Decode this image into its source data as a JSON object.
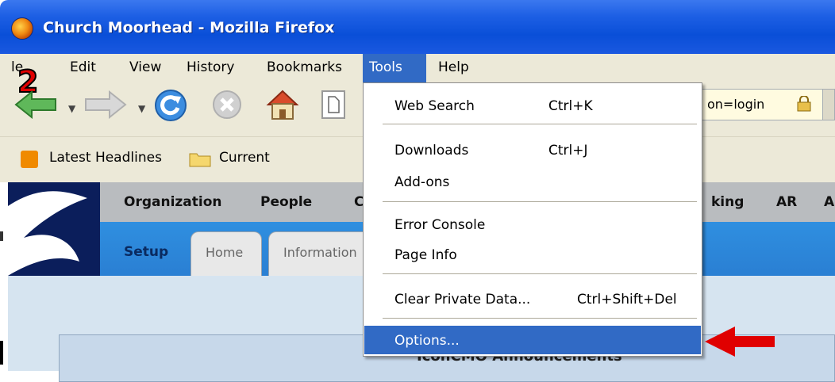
{
  "window": {
    "title": "Church Moorhead - Mozilla Firefox"
  },
  "annotation": {
    "step": "2"
  },
  "menubar": {
    "file": "le",
    "edit": "Edit",
    "view": "View",
    "history": "History",
    "bookmarks": "Bookmarks",
    "tools": "Tools",
    "help": "Help"
  },
  "urlbar": {
    "value_visible": "on=login"
  },
  "bookmarks_toolbar": {
    "items": [
      "Latest Headlines",
      "Current"
    ]
  },
  "tools_menu": {
    "items": [
      {
        "label": "Web Search",
        "shortcut": "Ctrl+K"
      },
      {
        "label": "Downloads",
        "shortcut": "Ctrl+J"
      },
      {
        "label": "Add-ons",
        "shortcut": ""
      },
      {
        "label": "Error Console",
        "shortcut": ""
      },
      {
        "label": "Page Info",
        "shortcut": ""
      },
      {
        "label": "Clear Private Data...",
        "shortcut": "Ctrl+Shift+Del"
      },
      {
        "label": "Options...",
        "shortcut": ""
      }
    ],
    "highlighted": "Options..."
  },
  "site": {
    "topnav": [
      "Organization",
      "People",
      "C",
      "king",
      "AR",
      "A"
    ],
    "subnav_label": "Setup",
    "tabs": [
      "Home",
      "Information"
    ],
    "panel_title": "IconCMO Announcements"
  },
  "colors": {
    "menu_highlight": "#316ac5",
    "arrow": "#e00000",
    "subnav": "#2a7fd3"
  }
}
